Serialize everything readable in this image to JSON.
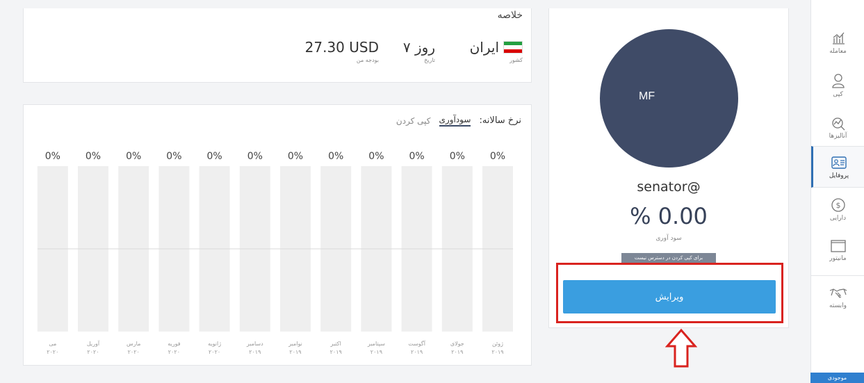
{
  "summary": {
    "title": "خلاصه",
    "country": {
      "value": "ایران",
      "label": "کشور",
      "flag_colors": [
        "#239f40",
        "#ffffff",
        "#da0000"
      ]
    },
    "history": {
      "value": "۷ روز",
      "label": "تاریخ"
    },
    "budget": {
      "value": "27.30 USD",
      "label": "بودجه من"
    }
  },
  "chart_section": {
    "rate_label": "نرخ سالانه:",
    "tabs": [
      {
        "label": "سودآوری",
        "active": true
      },
      {
        "label": "کپی کردن",
        "active": false
      }
    ]
  },
  "chart_data": {
    "type": "bar",
    "categories": [
      {
        "month": "ژوئن",
        "year": "۲۰۱۹"
      },
      {
        "month": "جولای",
        "year": "۲۰۱۹"
      },
      {
        "month": "آگوست",
        "year": "۲۰۱۹"
      },
      {
        "month": "سپتامبر",
        "year": "۲۰۱۹"
      },
      {
        "month": "اکتبر",
        "year": "۲۰۱۹"
      },
      {
        "month": "نوامبر",
        "year": "۲۰۱۹"
      },
      {
        "month": "دسامبر",
        "year": "۲۰۱۹"
      },
      {
        "month": "ژانویه",
        "year": "۲۰۲۰"
      },
      {
        "month": "فوریه",
        "year": "۲۰۲۰"
      },
      {
        "month": "مارس",
        "year": "۲۰۲۰"
      },
      {
        "month": "آوریل",
        "year": "۲۰۲۰"
      },
      {
        "month": "می",
        "year": "۲۰۲۰"
      }
    ],
    "values": [
      0,
      0,
      0,
      0,
      0,
      0,
      0,
      0,
      0,
      0,
      0,
      0
    ],
    "value_labels": [
      "0%",
      "0%",
      "0%",
      "0%",
      "0%",
      "0%",
      "0%",
      "0%",
      "0%",
      "0%",
      "0%",
      "0%"
    ],
    "colors": {
      "bar_bg": "#efefef",
      "midline": "#d9d9d9"
    }
  },
  "profile": {
    "initials": "MF",
    "username": "senator@",
    "profit": "% 0.00",
    "profit_label": "سود آوری",
    "copy_badge": "برای کپی کردن در دسترس نیست",
    "edit_label": "ویرایش",
    "avatar_color": "#3f4b67",
    "button_color": "#3a9ee0"
  },
  "sidebar": {
    "items": [
      {
        "label": "معامله",
        "icon": "chart-trade-icon"
      },
      {
        "label": "کپی",
        "icon": "user-copy-icon"
      },
      {
        "label": "آنالیزها",
        "icon": "analytics-icon"
      },
      {
        "label": "پروفایل",
        "icon": "profile-card-icon",
        "active": true
      },
      {
        "label": "دارایی",
        "icon": "dollar-circle-icon"
      },
      {
        "label": "مانیتور",
        "icon": "monitor-icon"
      },
      {
        "label": "وابسته",
        "icon": "handshake-icon"
      }
    ],
    "inventory_label": "موجودی"
  },
  "annotation": {
    "highlight_color": "#d9231f"
  }
}
